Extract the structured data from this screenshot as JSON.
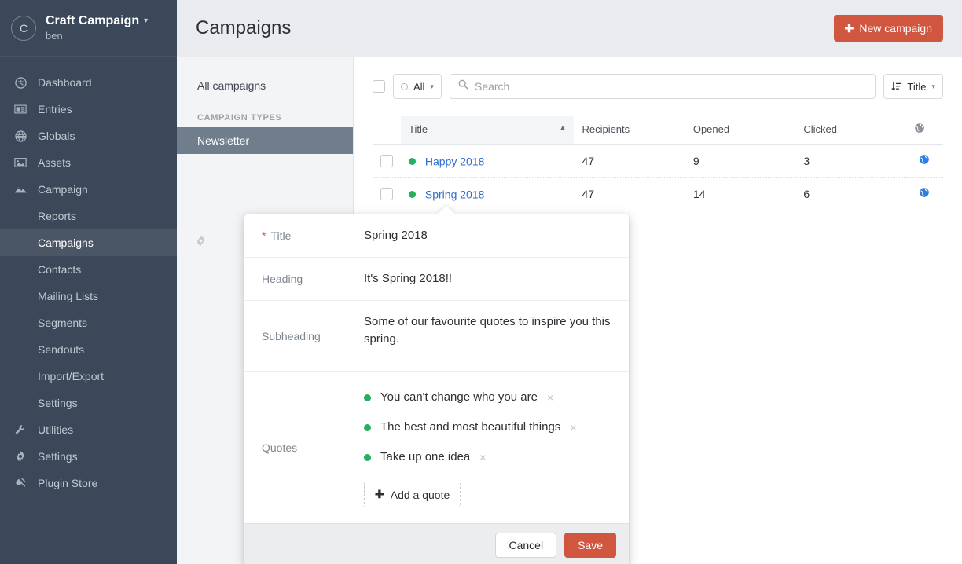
{
  "global_sidebar": {
    "avatar_initial": "C",
    "site_title": "Craft Campaign",
    "username": "ben",
    "items": [
      {
        "label": "Dashboard",
        "icon": "gauge-icon"
      },
      {
        "label": "Entries",
        "icon": "newspaper-icon"
      },
      {
        "label": "Globals",
        "icon": "globe-icon"
      },
      {
        "label": "Assets",
        "icon": "image-icon"
      },
      {
        "label": "Campaign",
        "icon": "mountain-icon"
      }
    ],
    "sub_items": [
      {
        "label": "Reports",
        "selected": false
      },
      {
        "label": "Campaigns",
        "selected": true
      },
      {
        "label": "Contacts",
        "selected": false
      },
      {
        "label": "Mailing Lists",
        "selected": false
      },
      {
        "label": "Segments",
        "selected": false
      },
      {
        "label": "Sendouts",
        "selected": false
      },
      {
        "label": "Import/Export",
        "selected": false
      },
      {
        "label": "Settings",
        "selected": false
      }
    ],
    "footer_items": [
      {
        "label": "Utilities",
        "icon": "wrench-icon"
      },
      {
        "label": "Settings",
        "icon": "gear-icon"
      },
      {
        "label": "Plugin Store",
        "icon": "plug-icon"
      }
    ]
  },
  "header": {
    "title": "Campaigns",
    "new_button": "New campaign",
    "new_button_color": "#d0563f"
  },
  "secondary_sidebar": {
    "all_campaigns": "All campaigns",
    "section_label": "Campaign Types",
    "types": [
      {
        "label": "Newsletter",
        "selected": true
      }
    ],
    "gear_icon": "gear-icon"
  },
  "toolbar": {
    "status_filter": "All",
    "search_placeholder": "Search",
    "search_value": "",
    "sort_label": "Title"
  },
  "table": {
    "columns": [
      "Title",
      "Recipients",
      "Opened",
      "Clicked"
    ],
    "sort_indicator": "▲",
    "globe_column_icon": "globe-icon",
    "rows": [
      {
        "status": "enabled",
        "title": "Happy 2018",
        "recipients": "47",
        "opened": "9",
        "clicked": "3",
        "globe": "globe-icon"
      },
      {
        "status": "enabled",
        "title": "Spring 2018",
        "recipients": "47",
        "opened": "14",
        "clicked": "6",
        "globe": "globe-icon"
      }
    ]
  },
  "modal": {
    "fields": {
      "title_label": "Title",
      "title_required_mark": "*",
      "title_value": "Spring 2018",
      "heading_label": "Heading",
      "heading_value": "It's Spring 2018!!",
      "subheading_label": "Subheading",
      "subheading_value": "Some of our favourite quotes to inspire you this spring.",
      "quotes_label": "Quotes"
    },
    "quotes": [
      {
        "text": "You can't change who you are",
        "delete": "×"
      },
      {
        "text": "The best and most beautiful things",
        "delete": "×"
      },
      {
        "text": "Take up one idea",
        "delete": "×"
      }
    ],
    "add_quote": "Add a quote",
    "cancel": "Cancel",
    "save": "Save",
    "save_color": "#d0563f"
  },
  "colors": {
    "sidebar_bg": "#3a4859",
    "accent_red": "#d0563f",
    "link_blue": "#2d6ed0",
    "status_green": "#27ae60"
  }
}
